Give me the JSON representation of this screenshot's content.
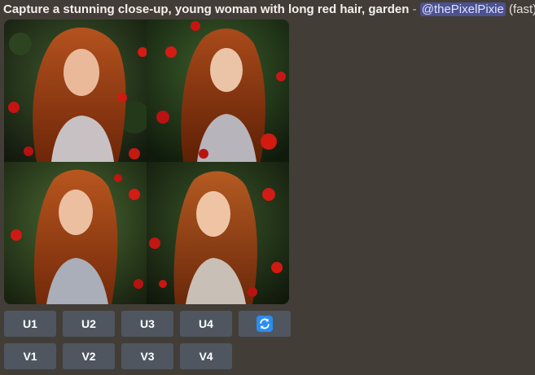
{
  "message": {
    "prompt": "Capture a stunning close-up, young woman with long red hair, garden",
    "separator": "-",
    "mention": "@thePixelPixie",
    "speed": "(fast)"
  },
  "upscale_buttons": [
    "U1",
    "U2",
    "U3",
    "U4"
  ],
  "variation_buttons": [
    "V1",
    "V2",
    "V3",
    "V4"
  ],
  "reroll_icon": "reroll-arrows-icon",
  "colors": {
    "background": "#423d37",
    "button": "#4f5660",
    "mention_bg": "#4c5190",
    "reroll_blue": "#2a8ef0"
  }
}
